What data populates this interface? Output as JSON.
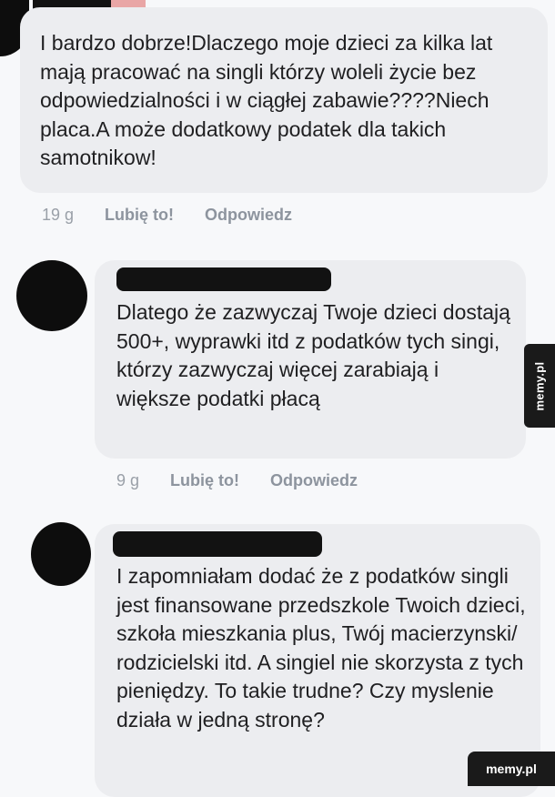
{
  "comments": [
    {
      "text": "I bardzo dobrze!Dlaczego moje dzieci za kilka lat mają pracować na singli którzy woleli życie bez odpowiedzialności i w ciągłej zabawie????Niech placa.A może dodatkowy podatek dla takich samotnikow!",
      "time": "19 g",
      "like_label": "Lubię to!",
      "reply_label": "Odpowiedz"
    },
    {
      "text": "Dlatego że zazwyczaj Twoje dzieci dostają 500+, wyprawki itd z podatków tych singi, którzy zazwyczaj więcej zarabiają i większe podatki płacą",
      "time": "9 g",
      "like_label": "Lubię to!",
      "reply_label": "Odpowiedz"
    },
    {
      "text": "I zapomniałam dodać że z podatków singli jest finansowane przedszkole Twoich dzieci, szkoła  mieszkania plus, Twój macierzynski/ rodzicielski itd. A singiel nie skorzysta z tych pieniędzy. To takie trudne? Czy myslenie działa w jedną stronę?"
    }
  ],
  "watermark": {
    "side": "memy.pl",
    "bottom": "memy.pl"
  }
}
